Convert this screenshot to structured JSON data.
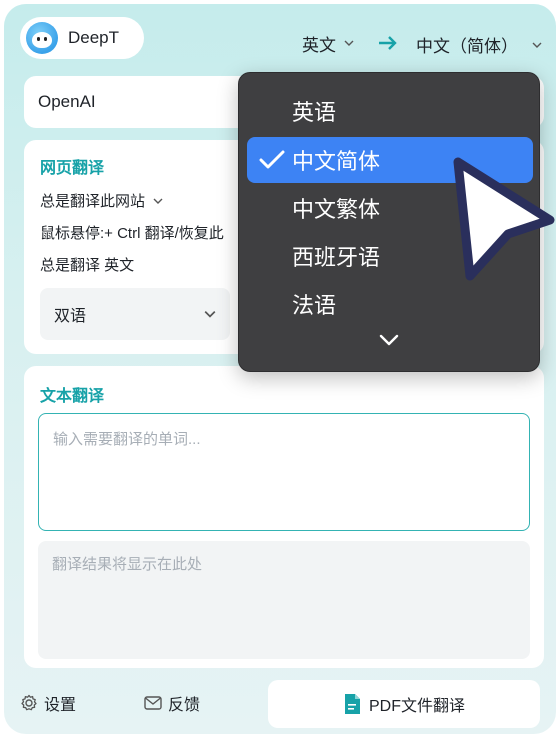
{
  "app": {
    "name": "DeepT"
  },
  "header": {
    "source_lang": "英文",
    "target_lang": "中文（简体）"
  },
  "engine": {
    "value": "OpenAI"
  },
  "web_translation": {
    "title": "网页翻译",
    "always_translate_site": "总是翻译此网站",
    "hover_hint": "鼠标悬停:+ Ctrl 翻译/恢复此",
    "always_translate_lang": "总是翻译 英文",
    "display_mode": "双语"
  },
  "text_translation": {
    "title": "文本翻译",
    "input_placeholder": "输入需要翻译的单词...",
    "output_placeholder": "翻译结果将显示在此处"
  },
  "footer": {
    "settings_label": "设置",
    "feedback_label": "反馈",
    "pdf_label": "PDF文件翻译"
  },
  "language_dropdown": {
    "items": [
      {
        "label": "英语",
        "selected": false
      },
      {
        "label": "中文简体",
        "selected": true
      },
      {
        "label": "中文繁体",
        "selected": false
      },
      {
        "label": "西班牙语",
        "selected": false
      },
      {
        "label": "法语",
        "selected": false
      }
    ]
  },
  "colors": {
    "accent": "#17a2a8",
    "selected": "#3d83f4",
    "dropdown_bg": "#3f3f41"
  },
  "icons": [
    "mascot-logo",
    "chevron-down-icon",
    "arrow-right-icon",
    "check-icon",
    "gear-icon",
    "mail-icon",
    "pdf-file-icon",
    "pointer-cursor-icon"
  ]
}
